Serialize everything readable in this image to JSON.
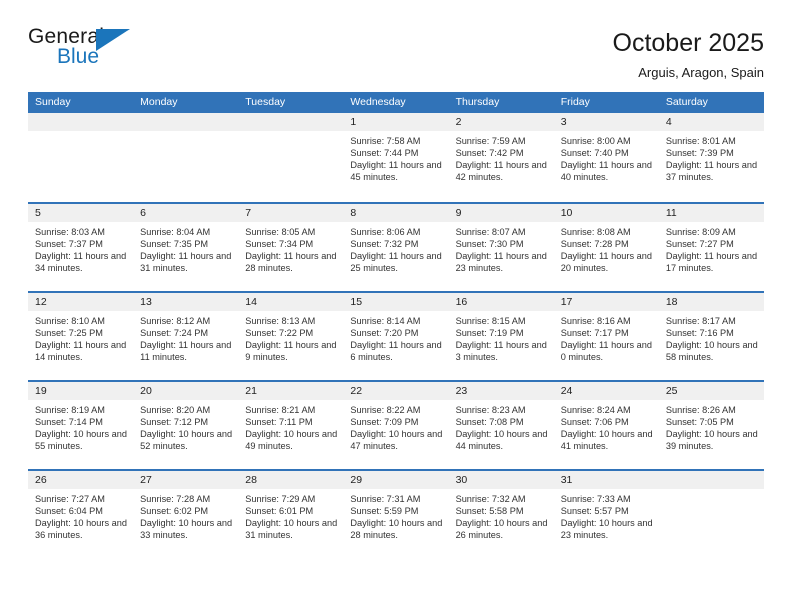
{
  "logo": {
    "text_primary": "General",
    "text_secondary": "Blue",
    "primary_color": "#1a1a1a",
    "accent_color": "#1b75bb"
  },
  "header": {
    "title": "October 2025",
    "subtitle": "Arguis, Aragon, Spain"
  },
  "theme": {
    "header_bar_color": "#3173b8",
    "day_strip_color": "#f0f0f0",
    "text_color": "#333333"
  },
  "weekday_headers": [
    "Sunday",
    "Monday",
    "Tuesday",
    "Wednesday",
    "Thursday",
    "Friday",
    "Saturday"
  ],
  "labels": {
    "sunrise": "Sunrise:",
    "sunset": "Sunset:",
    "daylight": "Daylight:"
  },
  "weeks": [
    [
      {
        "day": "",
        "empty": true,
        "sunrise": "",
        "sunset": "",
        "daylight": ""
      },
      {
        "day": "",
        "empty": true,
        "sunrise": "",
        "sunset": "",
        "daylight": ""
      },
      {
        "day": "",
        "empty": true,
        "sunrise": "",
        "sunset": "",
        "daylight": ""
      },
      {
        "day": "1",
        "empty": false,
        "sunrise": "Sunrise: 7:58 AM",
        "sunset": "Sunset: 7:44 PM",
        "daylight": "Daylight: 11 hours and 45 minutes."
      },
      {
        "day": "2",
        "empty": false,
        "sunrise": "Sunrise: 7:59 AM",
        "sunset": "Sunset: 7:42 PM",
        "daylight": "Daylight: 11 hours and 42 minutes."
      },
      {
        "day": "3",
        "empty": false,
        "sunrise": "Sunrise: 8:00 AM",
        "sunset": "Sunset: 7:40 PM",
        "daylight": "Daylight: 11 hours and 40 minutes."
      },
      {
        "day": "4",
        "empty": false,
        "sunrise": "Sunrise: 8:01 AM",
        "sunset": "Sunset: 7:39 PM",
        "daylight": "Daylight: 11 hours and 37 minutes."
      }
    ],
    [
      {
        "day": "5",
        "empty": false,
        "sunrise": "Sunrise: 8:03 AM",
        "sunset": "Sunset: 7:37 PM",
        "daylight": "Daylight: 11 hours and 34 minutes."
      },
      {
        "day": "6",
        "empty": false,
        "sunrise": "Sunrise: 8:04 AM",
        "sunset": "Sunset: 7:35 PM",
        "daylight": "Daylight: 11 hours and 31 minutes."
      },
      {
        "day": "7",
        "empty": false,
        "sunrise": "Sunrise: 8:05 AM",
        "sunset": "Sunset: 7:34 PM",
        "daylight": "Daylight: 11 hours and 28 minutes."
      },
      {
        "day": "8",
        "empty": false,
        "sunrise": "Sunrise: 8:06 AM",
        "sunset": "Sunset: 7:32 PM",
        "daylight": "Daylight: 11 hours and 25 minutes."
      },
      {
        "day": "9",
        "empty": false,
        "sunrise": "Sunrise: 8:07 AM",
        "sunset": "Sunset: 7:30 PM",
        "daylight": "Daylight: 11 hours and 23 minutes."
      },
      {
        "day": "10",
        "empty": false,
        "sunrise": "Sunrise: 8:08 AM",
        "sunset": "Sunset: 7:28 PM",
        "daylight": "Daylight: 11 hours and 20 minutes."
      },
      {
        "day": "11",
        "empty": false,
        "sunrise": "Sunrise: 8:09 AM",
        "sunset": "Sunset: 7:27 PM",
        "daylight": "Daylight: 11 hours and 17 minutes."
      }
    ],
    [
      {
        "day": "12",
        "empty": false,
        "sunrise": "Sunrise: 8:10 AM",
        "sunset": "Sunset: 7:25 PM",
        "daylight": "Daylight: 11 hours and 14 minutes."
      },
      {
        "day": "13",
        "empty": false,
        "sunrise": "Sunrise: 8:12 AM",
        "sunset": "Sunset: 7:24 PM",
        "daylight": "Daylight: 11 hours and 11 minutes."
      },
      {
        "day": "14",
        "empty": false,
        "sunrise": "Sunrise: 8:13 AM",
        "sunset": "Sunset: 7:22 PM",
        "daylight": "Daylight: 11 hours and 9 minutes."
      },
      {
        "day": "15",
        "empty": false,
        "sunrise": "Sunrise: 8:14 AM",
        "sunset": "Sunset: 7:20 PM",
        "daylight": "Daylight: 11 hours and 6 minutes."
      },
      {
        "day": "16",
        "empty": false,
        "sunrise": "Sunrise: 8:15 AM",
        "sunset": "Sunset: 7:19 PM",
        "daylight": "Daylight: 11 hours and 3 minutes."
      },
      {
        "day": "17",
        "empty": false,
        "sunrise": "Sunrise: 8:16 AM",
        "sunset": "Sunset: 7:17 PM",
        "daylight": "Daylight: 11 hours and 0 minutes."
      },
      {
        "day": "18",
        "empty": false,
        "sunrise": "Sunrise: 8:17 AM",
        "sunset": "Sunset: 7:16 PM",
        "daylight": "Daylight: 10 hours and 58 minutes."
      }
    ],
    [
      {
        "day": "19",
        "empty": false,
        "sunrise": "Sunrise: 8:19 AM",
        "sunset": "Sunset: 7:14 PM",
        "daylight": "Daylight: 10 hours and 55 minutes."
      },
      {
        "day": "20",
        "empty": false,
        "sunrise": "Sunrise: 8:20 AM",
        "sunset": "Sunset: 7:12 PM",
        "daylight": "Daylight: 10 hours and 52 minutes."
      },
      {
        "day": "21",
        "empty": false,
        "sunrise": "Sunrise: 8:21 AM",
        "sunset": "Sunset: 7:11 PM",
        "daylight": "Daylight: 10 hours and 49 minutes."
      },
      {
        "day": "22",
        "empty": false,
        "sunrise": "Sunrise: 8:22 AM",
        "sunset": "Sunset: 7:09 PM",
        "daylight": "Daylight: 10 hours and 47 minutes."
      },
      {
        "day": "23",
        "empty": false,
        "sunrise": "Sunrise: 8:23 AM",
        "sunset": "Sunset: 7:08 PM",
        "daylight": "Daylight: 10 hours and 44 minutes."
      },
      {
        "day": "24",
        "empty": false,
        "sunrise": "Sunrise: 8:24 AM",
        "sunset": "Sunset: 7:06 PM",
        "daylight": "Daylight: 10 hours and 41 minutes."
      },
      {
        "day": "25",
        "empty": false,
        "sunrise": "Sunrise: 8:26 AM",
        "sunset": "Sunset: 7:05 PM",
        "daylight": "Daylight: 10 hours and 39 minutes."
      }
    ],
    [
      {
        "day": "26",
        "empty": false,
        "sunrise": "Sunrise: 7:27 AM",
        "sunset": "Sunset: 6:04 PM",
        "daylight": "Daylight: 10 hours and 36 minutes."
      },
      {
        "day": "27",
        "empty": false,
        "sunrise": "Sunrise: 7:28 AM",
        "sunset": "Sunset: 6:02 PM",
        "daylight": "Daylight: 10 hours and 33 minutes."
      },
      {
        "day": "28",
        "empty": false,
        "sunrise": "Sunrise: 7:29 AM",
        "sunset": "Sunset: 6:01 PM",
        "daylight": "Daylight: 10 hours and 31 minutes."
      },
      {
        "day": "29",
        "empty": false,
        "sunrise": "Sunrise: 7:31 AM",
        "sunset": "Sunset: 5:59 PM",
        "daylight": "Daylight: 10 hours and 28 minutes."
      },
      {
        "day": "30",
        "empty": false,
        "sunrise": "Sunrise: 7:32 AM",
        "sunset": "Sunset: 5:58 PM",
        "daylight": "Daylight: 10 hours and 26 minutes."
      },
      {
        "day": "31",
        "empty": false,
        "sunrise": "Sunrise: 7:33 AM",
        "sunset": "Sunset: 5:57 PM",
        "daylight": "Daylight: 10 hours and 23 minutes."
      },
      {
        "day": "",
        "empty": true,
        "sunrise": "",
        "sunset": "",
        "daylight": ""
      }
    ]
  ]
}
